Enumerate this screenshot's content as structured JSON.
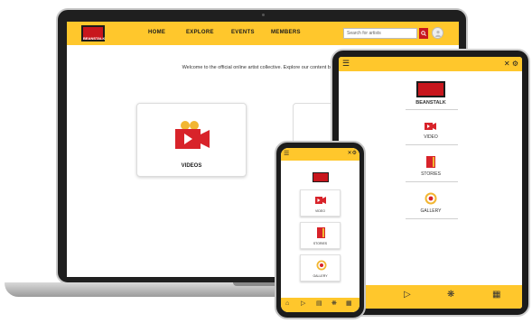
{
  "brand": {
    "accent": "#ffc72c",
    "red": "#c8161d",
    "dark": "#1c1c1c"
  },
  "laptop": {
    "logo_text": "BEANSTALK",
    "menu": [
      {
        "label": "HOME"
      },
      {
        "label": "EXPLORE"
      },
      {
        "label": "EVENTS"
      },
      {
        "label": "MEMBERS"
      }
    ],
    "search_placeholder": "Search for artists",
    "search_icon": "search-icon",
    "intro_text": "Welcome to the official online artist collective. Explore our content below.",
    "card_label": "VIDEOS"
  },
  "tablet": {
    "logo_text": "BEANSTALK",
    "items": [
      {
        "label": "VIDEO",
        "icon": "video-camera-icon"
      },
      {
        "label": "STORIES",
        "icon": "book-icon"
      },
      {
        "label": "GALLERY",
        "icon": "gallery-icon"
      }
    ],
    "bottom_icons": [
      "home-icon",
      "play-icon",
      "sparkle-icon",
      "grid-icon"
    ]
  },
  "phone": {
    "items": [
      {
        "label": "VIDEO",
        "icon": "video-camera-icon"
      },
      {
        "label": "STORIES",
        "icon": "book-icon"
      },
      {
        "label": "GALLERY",
        "icon": "gallery-icon"
      }
    ],
    "bottom_icons": [
      "home-icon",
      "play-icon",
      "book-icon",
      "sparkle-icon",
      "grid-icon"
    ]
  }
}
